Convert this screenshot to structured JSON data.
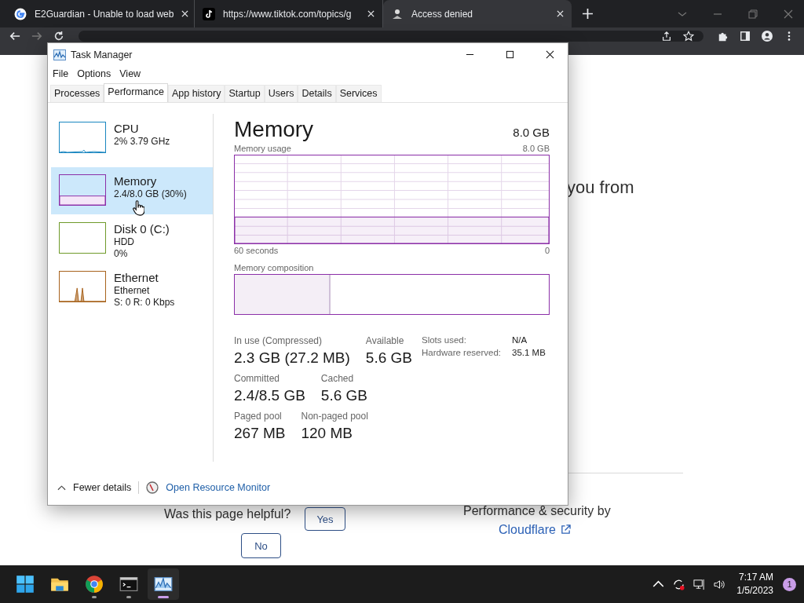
{
  "browser": {
    "tabs": [
      {
        "title": "E2Guardian - Unable to load web",
        "selected": false,
        "kind": "google"
      },
      {
        "title": "https://www.tiktok.com/topics/g",
        "selected": false,
        "kind": "tiktok"
      },
      {
        "title": "Access denied",
        "selected": true,
        "kind": "shield"
      }
    ],
    "page": {
      "heading_fragment": "you from",
      "helpful_question": "Was this page helpful?",
      "yes_button": "Yes",
      "no_button": "No",
      "footer_text": "Performance & security by",
      "footer_link": "Cloudflare"
    }
  },
  "task_manager": {
    "title": "Task Manager",
    "menu": [
      "File",
      "Options",
      "View"
    ],
    "tabs": [
      {
        "label": "Processes",
        "selected": false
      },
      {
        "label": "Performance",
        "selected": true
      },
      {
        "label": "App history",
        "selected": false
      },
      {
        "label": "Startup",
        "selected": false
      },
      {
        "label": "Users",
        "selected": false
      },
      {
        "label": "Details",
        "selected": false
      },
      {
        "label": "Services",
        "selected": false
      }
    ],
    "sidebar": [
      {
        "name": "CPU",
        "lines": [
          "2% 3.79 GHz"
        ],
        "color": "#1986c0",
        "kind": "spikes-low",
        "selected": false
      },
      {
        "name": "Memory",
        "lines": [
          "2.4/8.0 GB (30%)"
        ],
        "color": "#8b2fa8",
        "kind": "fill",
        "selected": true
      },
      {
        "name": "Disk 0 (C:)",
        "lines": [
          "HDD",
          "0%"
        ],
        "color": "#6f9a2a",
        "kind": "flat",
        "selected": false
      },
      {
        "name": "Ethernet",
        "lines": [
          "Ethernet",
          "S: 0 R: 0 Kbps"
        ],
        "color": "#a8631c",
        "kind": "spikes",
        "selected": false
      }
    ],
    "heading": "Memory",
    "total": "8.0 GB",
    "usage_graph": {
      "label": "Memory usage",
      "max": "8.0 GB",
      "time_label": "60 seconds",
      "min": "0"
    },
    "composition": {
      "label": "Memory composition",
      "level": 0.3
    },
    "stats": [
      [
        {
          "label": "In use (Compressed)",
          "value": "2.3 GB (27.2 MB)"
        },
        {
          "label": "Available",
          "value": "5.6 GB"
        }
      ],
      [
        {
          "label": "Committed",
          "value": "2.4/8.5 GB"
        },
        {
          "label": "Cached",
          "value": "5.6 GB"
        }
      ],
      [
        {
          "label": "Paged pool",
          "value": "267 MB"
        },
        {
          "label": "Non-paged pool",
          "value": "120 MB"
        }
      ]
    ],
    "details": [
      {
        "label": "Slots used:",
        "value": "N/A"
      },
      {
        "label": "Hardware reserved:",
        "value": "35.1 MB"
      }
    ],
    "footer": {
      "fewer": "Fewer details",
      "monitor": "Open Resource Monitor"
    }
  },
  "taskbar": {
    "apps": [
      {
        "kind": "start",
        "running": false,
        "active": false
      },
      {
        "kind": "folder",
        "running": false,
        "active": false
      },
      {
        "kind": "chrome",
        "running": true,
        "active": false
      },
      {
        "kind": "terminal",
        "running": true,
        "active": false
      },
      {
        "kind": "taskmgr",
        "running": true,
        "active": true
      }
    ],
    "time": "7:17 AM",
    "date": "1/5/2023",
    "notifications": "1"
  }
}
